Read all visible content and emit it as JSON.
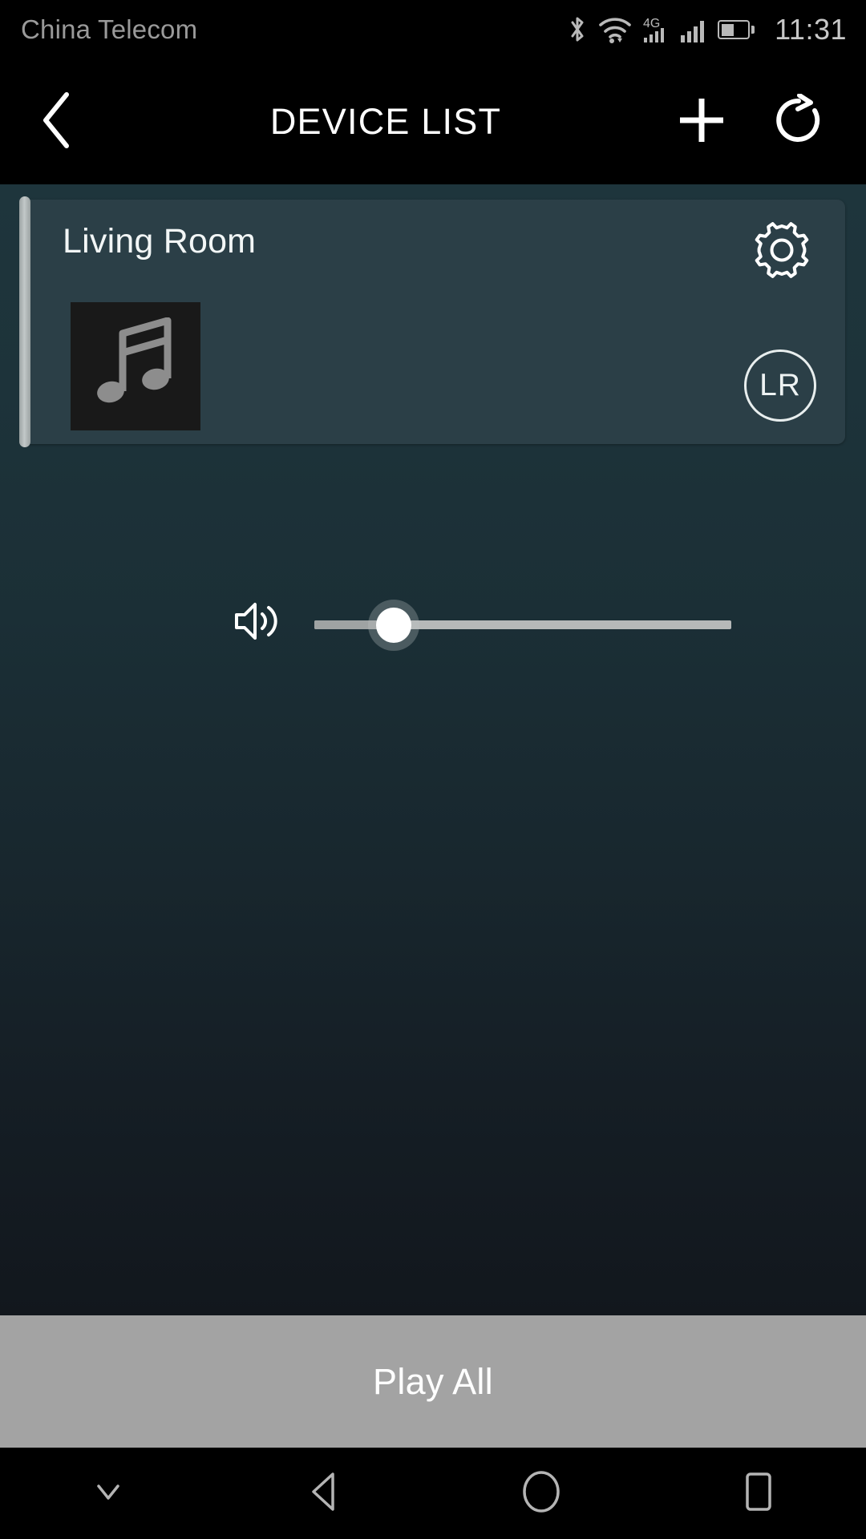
{
  "status_bar": {
    "carrier": "China Telecom",
    "clock": "11:31",
    "battery_percent": 42,
    "network_label": "4G",
    "icons": [
      "bluetooth-icon",
      "wifi-icon",
      "network-4g-icon",
      "signal-bars-icon",
      "battery-icon"
    ]
  },
  "app_bar": {
    "title": "DEVICE LIST",
    "back_icon": "chevron-left-icon",
    "add_icon": "plus-icon",
    "refresh_icon": "refresh-icon"
  },
  "devices": [
    {
      "name": "Living Room",
      "album_art_icon": "music-note-icon",
      "settings_icon": "gear-icon",
      "volume_icon": "speaker-volume-icon",
      "volume_percent": 19,
      "channel_label": "LR"
    }
  ],
  "footer": {
    "play_all_label": "Play All"
  },
  "nav_bar": {
    "items": [
      {
        "icon": "chevron-down-icon",
        "name": "hide-keyboard"
      },
      {
        "icon": "triangle-left-icon",
        "name": "back"
      },
      {
        "icon": "circle-icon",
        "name": "home"
      },
      {
        "icon": "square-icon",
        "name": "recents"
      }
    ]
  },
  "colors": {
    "background_top": "#1e353c",
    "background_bottom": "#12171d",
    "card": "#2b3f47",
    "accent_bar": "#c2c8c8",
    "play_all_bar": "#a3a3a3",
    "text_primary": "#ffffff",
    "text_muted": "#9a9a9a"
  }
}
